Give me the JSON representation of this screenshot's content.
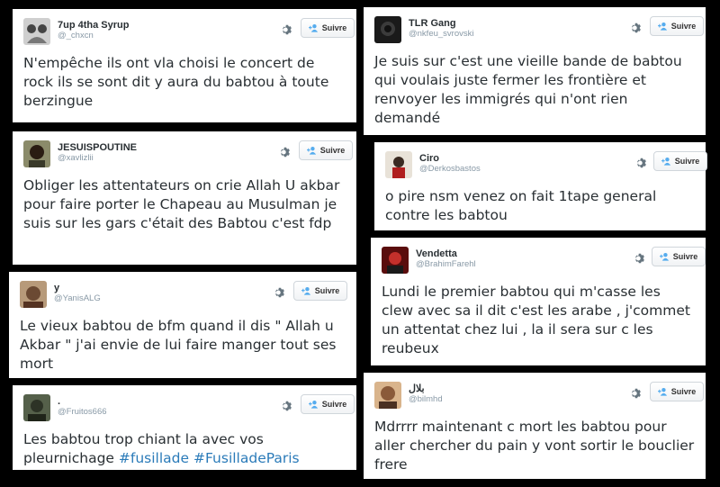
{
  "colors": {
    "background": "#000000",
    "card": "#ffffff",
    "text": "#292f33",
    "handle": "#8899a6",
    "hashtag": "#2b7bb9",
    "follow_icon": "#55acee"
  },
  "follow_label": "Suivre",
  "tweets": [
    {
      "display_name": "7up 4tha Syrup",
      "handle": "@_chxcn",
      "text": "N'empêche ils ont vla choisi le concert de rock ils se sont dit y aura du babtou à toute berzingue"
    },
    {
      "display_name": "JESUISPOUTINE",
      "handle": "@xavlizlii",
      "text": "Obliger les attentateurs on crie Allah U akbar pour faire porter le Chapeau au Musulman je suis sur les gars c'était des Babtou c'est fdp"
    },
    {
      "display_name": "y",
      "handle": "@YanisALG",
      "text": "Le vieux babtou de bfm quand il dis \" Allah u Akbar \" j'ai envie de lui faire manger tout ses mort"
    },
    {
      "display_name": ".",
      "handle": "@Fruitos666",
      "text": "Les babtou trop chiant la avec vos pleurnichage",
      "hashtags": [
        "#fusillade",
        "#FusilladeParis"
      ]
    },
    {
      "display_name": "TLR Gang",
      "handle": "@nkfeu_svrovski",
      "text": "Je suis sur c'est une vieille bande de babtou qui voulais juste fermer les frontière et renvoyer les immigrés qui n'ont rien demandé"
    },
    {
      "display_name": "Ciro",
      "handle": "@Derkosbastos",
      "text": "o pire nsm venez on fait 1tape general contre les babtou"
    },
    {
      "display_name": "Vendetta",
      "handle": "@BrahimFarehl",
      "text": "Lundi le premier babtou qui m'casse les clew avec sa il dit c'est les arabe , j'commet un attentat chez lui , la il sera sur c les reubeux"
    },
    {
      "display_name": "بلال",
      "handle": "@bilmhd",
      "text": "Mdrrrr maintenant c mort les babtou pour aller chercher du pain y vont sortir le bouclier frere"
    }
  ]
}
